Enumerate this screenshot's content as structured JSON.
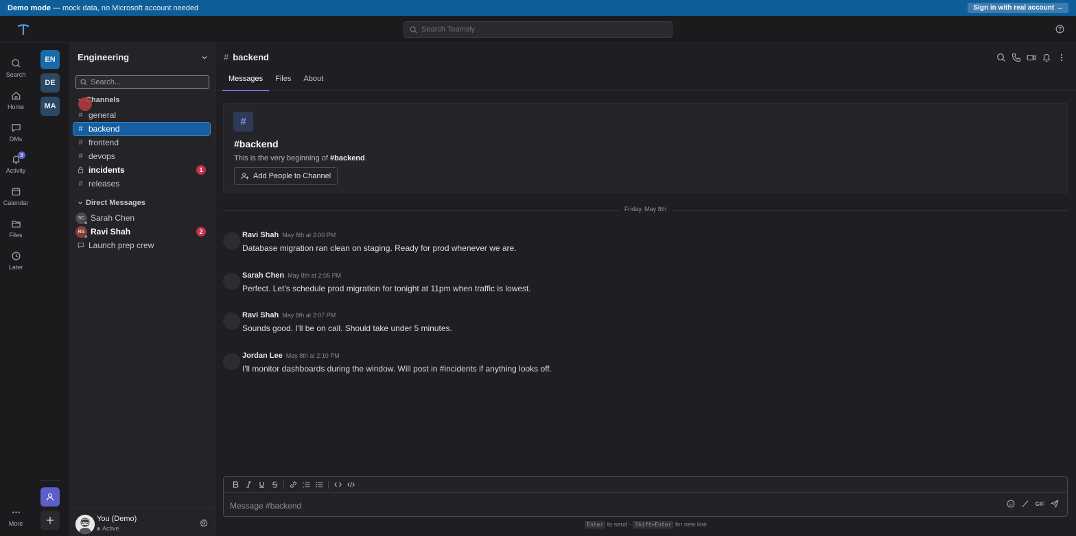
{
  "banner": {
    "mode": "Demo mode",
    "rest": "— mock data, no Microsoft account needed",
    "signin": "Sign in with real account →"
  },
  "topbar": {
    "search_placeholder": "Search Teamsly"
  },
  "nav": [
    {
      "label": "Search",
      "icon": "search-icon"
    },
    {
      "label": "Home",
      "icon": "home-icon"
    },
    {
      "label": "DMs",
      "icon": "chat-icon"
    },
    {
      "label": "Activity",
      "icon": "bell-icon",
      "badge": "3"
    },
    {
      "label": "Calendar",
      "icon": "calendar-icon"
    },
    {
      "label": "Files",
      "icon": "folder-icon"
    },
    {
      "label": "Later",
      "icon": "clock-icon"
    },
    {
      "label": "More",
      "icon": "more-icon"
    }
  ],
  "teams": [
    "EN",
    "DE",
    "MA"
  ],
  "sidebar": {
    "team_name": "Engineering",
    "search_placeholder": "Search...",
    "channels_header": "Channels",
    "channels": [
      {
        "name": "general"
      },
      {
        "name": "backend",
        "selected": true
      },
      {
        "name": "frontend"
      },
      {
        "name": "devops"
      },
      {
        "name": "incidents",
        "bold": true,
        "badge": "1",
        "private": true
      },
      {
        "name": "releases"
      }
    ],
    "dm_header": "Direct Messages",
    "dms": [
      {
        "initials": "SC",
        "name": "Sarah Chen",
        "color": "#4a4a50"
      },
      {
        "initials": "RS",
        "name": "Ravi Shah",
        "color": "#8c3a3a",
        "bold": true,
        "badge": "2"
      },
      {
        "name": "Launch prep crew",
        "group": true
      }
    ],
    "me": {
      "name": "You (Demo)",
      "status": "Active"
    }
  },
  "channel": {
    "name": "backend",
    "tabs": [
      "Messages",
      "Files",
      "About"
    ],
    "intro_title": "#backend",
    "intro_desc_prefix": "This is the very beginning of ",
    "intro_desc_channel": "#backend",
    "intro_desc_suffix": ".",
    "add_people": "Add People to Channel",
    "date_sep": "Friday, May 8th",
    "messages": [
      {
        "author": "Ravi Shah",
        "time": "May 8th at 2:00 PM",
        "text": "Database migration ran clean on staging. Ready for prod whenever we are."
      },
      {
        "author": "Sarah Chen",
        "time": "May 8th at 2:05 PM",
        "text": "Perfect. Let's schedule prod migration for tonight at 11pm when traffic is lowest."
      },
      {
        "author": "Ravi Shah",
        "time": "May 8th at 2:07 PM",
        "text": "Sounds good. I'll be on call. Should take under 5 minutes."
      },
      {
        "author": "Jordan Lee",
        "time": "May 8th at 2:10 PM",
        "text": "I'll monitor dashboards during the window. Will post in #incidents if anything looks off."
      }
    ],
    "composer_placeholder": "Message #backend",
    "gif_label": "GIF",
    "hint": {
      "enter": "Enter",
      "to_send": "to send ·",
      "shift_enter": "Shift+Enter",
      "new_line": "for new line"
    }
  },
  "colors": {
    "accent": "#5b5fc7",
    "selected": "#175ea1",
    "badge": "#c4314b",
    "banner": "#0e5f99"
  }
}
